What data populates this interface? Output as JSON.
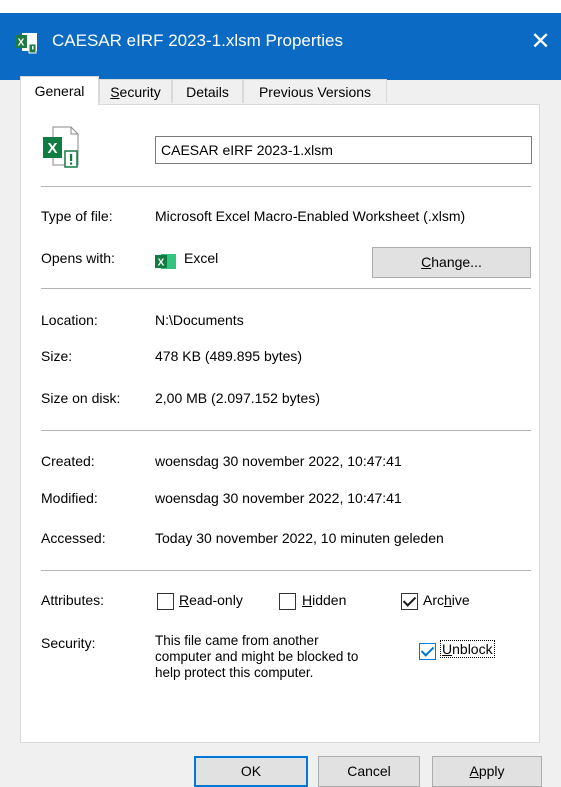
{
  "window": {
    "title": "CAESAR eIRF 2023-1.xlsm Properties",
    "close_glyph": "✕"
  },
  "tabs": [
    {
      "label": "General",
      "active": true
    },
    {
      "label": "Security",
      "active": false
    },
    {
      "label": "Details",
      "active": false
    },
    {
      "label": "Previous Versions",
      "active": false
    }
  ],
  "general": {
    "file_name": "CAESAR eIRF 2023-1.xlsm",
    "type_label": "Type of file:",
    "type_value": "Microsoft Excel Macro-Enabled Worksheet (.xlsm)",
    "opens_label": "Opens with:",
    "opens_value": "Excel",
    "change_button": "Change...",
    "location_label": "Location:",
    "location_value": "N:\\Documents",
    "size_label": "Size:",
    "size_value": "478 KB (489.895 bytes)",
    "size_disk_label": "Size on disk:",
    "size_disk_value": "2,00 MB (2.097.152 bytes)",
    "created_label": "Created:",
    "created_value": "woensdag 30 november 2022, 10:47:41",
    "modified_label": "Modified:",
    "modified_value": "woensdag 30 november 2022, 10:47:41",
    "accessed_label": "Accessed:",
    "accessed_value": "Today 30 november 2022, 10 minuten geleden",
    "attributes_label": "Attributes:",
    "attributes": {
      "readonly": {
        "label": "Read-only",
        "checked": false
      },
      "hidden": {
        "label": "Hidden",
        "checked": false
      },
      "archive": {
        "label": "Archive",
        "checked": true
      }
    },
    "security_label": "Security:",
    "security_text_1": "This file came from another",
    "security_text_2": "computer and might be blocked to",
    "security_text_3": "help protect this computer.",
    "unblock": {
      "label": "Unblock",
      "checked": true
    }
  },
  "footer": {
    "ok": "OK",
    "cancel": "Cancel",
    "apply": "Apply"
  },
  "colors": {
    "titlebar": "#0b6ac4",
    "excel_green": "#107c41",
    "focus_blue": "#0078d7"
  }
}
